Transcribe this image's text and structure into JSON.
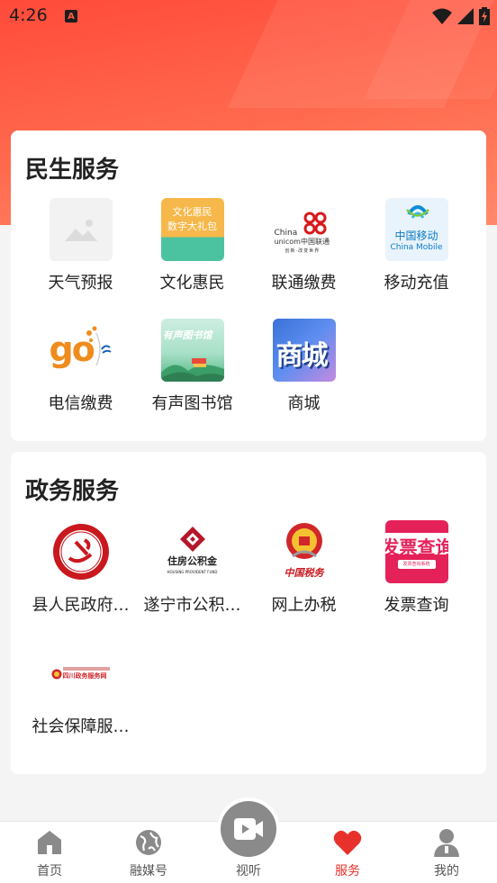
{
  "status_bar": {
    "time": "4:26"
  },
  "sections": {
    "livelihood": {
      "title": "民生服务",
      "items": [
        {
          "label": "天气预报",
          "icon": "image-placeholder-icon"
        },
        {
          "label": "文化惠民",
          "icon": "culture-icon",
          "icon_text_1": "文化惠民",
          "icon_text_2": "数字大礼包"
        },
        {
          "label": "联通缴费",
          "icon": "china-unicom-icon",
          "icon_text_1": "China",
          "icon_text_2": "unicom中国联通",
          "icon_text_3": "创新·改变世界"
        },
        {
          "label": "移动充值",
          "icon": "china-mobile-icon",
          "icon_text_1": "中国移动",
          "icon_text_2": "China Mobile"
        },
        {
          "label": "电信缴费",
          "icon": "china-telecom-icon",
          "icon_text_1": "go"
        },
        {
          "label": "有声图书馆",
          "icon": "audio-library-icon",
          "icon_text_1": "有声图书馆"
        },
        {
          "label": "商城",
          "icon": "mall-icon",
          "icon_text_1": "商城"
        }
      ]
    },
    "government": {
      "title": "政务服务",
      "items": [
        {
          "label": "县人民政府…",
          "icon": "county-government-icon"
        },
        {
          "label": "遂宁市公积…",
          "icon": "housing-fund-icon",
          "icon_text_1": "住房公积金",
          "icon_text_2": "HOUSING PROVIDENT FUND"
        },
        {
          "label": "网上办税",
          "icon": "tax-bureau-icon",
          "icon_text_1": "中国税务"
        },
        {
          "label": "发票查询",
          "icon": "invoice-query-icon",
          "icon_text_1": "发票查询",
          "icon_text_2": "发票查询系统"
        },
        {
          "label": "社会保障服…",
          "icon": "sichuan-gov-service-icon",
          "icon_text_1": "四川政务服务网"
        }
      ]
    }
  },
  "bottom_nav": {
    "items": [
      {
        "label": "首页",
        "icon": "home-icon"
      },
      {
        "label": "融媒号",
        "icon": "globe-icon"
      },
      {
        "label": "视听",
        "icon": "video-icon"
      },
      {
        "label": "服务",
        "icon": "heart-icon"
      },
      {
        "label": "我的",
        "icon": "user-icon"
      }
    ],
    "active": "服务"
  },
  "colors": {
    "accent": "#e8312a",
    "header": "#ff5a44"
  }
}
